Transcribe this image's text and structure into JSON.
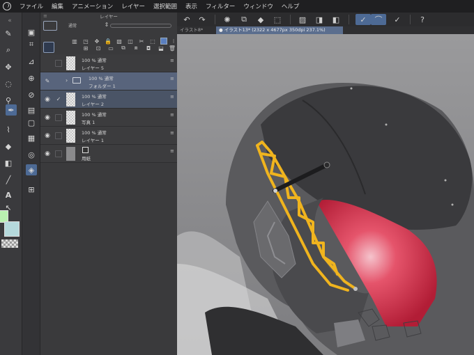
{
  "menu": {
    "items": [
      "ファイル",
      "編集",
      "アニメーション",
      "レイヤー",
      "選択範囲",
      "表示",
      "フィルター",
      "ウィンドウ",
      "ヘルプ"
    ]
  },
  "layer_panel": {
    "title": "レイヤー",
    "blend_mode": "通常",
    "layers": [
      {
        "line1": "100 % 通常",
        "line2": "レイヤー 5",
        "visible": false,
        "type": "raster"
      },
      {
        "line1": "100 % 通常",
        "line2": "フォルダー 1",
        "visible": false,
        "type": "folder"
      },
      {
        "line1": "100 % 通常",
        "line2": "レイヤー 2",
        "visible": true,
        "type": "raster"
      },
      {
        "line1": "100 % 通常",
        "line2": "写真 1",
        "visible": true,
        "type": "raster"
      },
      {
        "line1": "100 % 通常",
        "line2": "レイヤー 1",
        "visible": true,
        "type": "raster"
      },
      {
        "line1": "",
        "line2": "用紙",
        "visible": true,
        "type": "paper"
      }
    ]
  },
  "tabs": {
    "inactive": "イラスト8*",
    "active": "● イラスト13* (2322 x 4677px 350dpi 237.1%)"
  },
  "colors": {
    "accent": "#4d6a95",
    "main_color": "#b9f0b0",
    "sub_color": "#b5d9dc",
    "highlight_orange": "#f0b41e",
    "visor_red": "#d23246"
  }
}
